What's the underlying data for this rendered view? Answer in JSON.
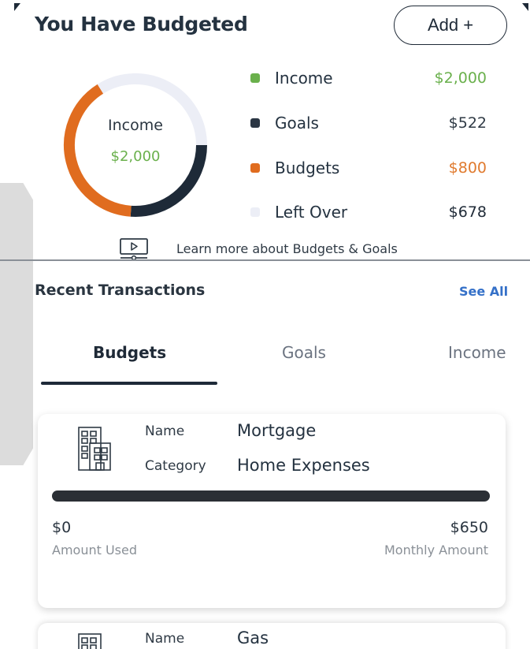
{
  "header": {
    "title": "You Have Budgeted",
    "add_label": "Add +"
  },
  "donut": {
    "center_label": "Income",
    "center_amount": "$2,000",
    "segments": [
      {
        "name": "Goals",
        "value": 522,
        "color": "#1e2a38"
      },
      {
        "name": "Budgets",
        "value": 800,
        "color": "#e06c1f"
      },
      {
        "name": "Left Over",
        "value": 678,
        "color": "#eceef6"
      }
    ]
  },
  "legend": [
    {
      "name": "Income",
      "value": "$2,000",
      "dot_color": "#6ab04c",
      "value_color": "#6ab04c"
    },
    {
      "name": "Goals",
      "value": "$522",
      "dot_color": "#2b3644",
      "value_color": "#2f3a45"
    },
    {
      "name": "Budgets",
      "value": "$800",
      "dot_color": "#e06c1f",
      "value_color": "#e07a2e"
    },
    {
      "name": "Left Over",
      "value": "$678",
      "dot_color": "#eceef6",
      "value_color": "#1f2a37"
    }
  ],
  "learn_more": "Learn more about Budgets & Goals",
  "recent": {
    "title": "Recent Transactions",
    "see_all": "See All"
  },
  "tabs": [
    {
      "label": "Budgets",
      "active": true
    },
    {
      "label": "Goals",
      "active": false
    },
    {
      "label": "Income",
      "active": false
    }
  ],
  "cards": [
    {
      "name_key": "Name",
      "name": "Mortgage",
      "category_key": "Category",
      "category": "Home Expenses",
      "used": "$0",
      "used_caption": "Amount Used",
      "monthly": "$650",
      "monthly_caption": "Monthly Amount",
      "progress": 0
    },
    {
      "name_key": "Name",
      "name": "Gas"
    }
  ]
}
